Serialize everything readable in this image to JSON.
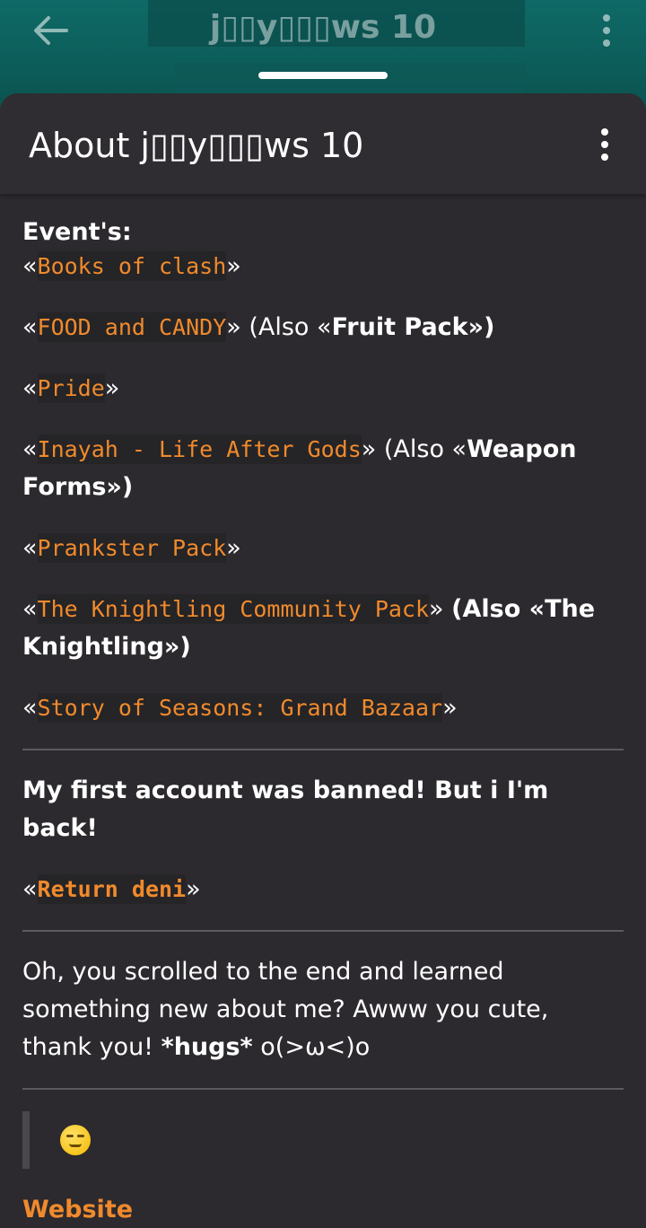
{
  "topbar": {
    "title": "j▯▯y▯▯▯ws 10"
  },
  "sheet": {
    "title": "About j▯▯y▯▯▯ws 10"
  },
  "content": {
    "events_heading": "Event's:",
    "lines": [
      {
        "code": "Books of clash",
        "suffix": "",
        "bold_tail": ""
      },
      {
        "code": "FOOD and CANDY",
        "suffix": " (Also «",
        "bold_tail": "Fruit Pack»)"
      },
      {
        "code": "Pride",
        "suffix": "",
        "bold_tail": ""
      },
      {
        "code": "Inayah - Life After Gods",
        "suffix": " (Also «",
        "bold_tail": "Weapon Forms»)"
      },
      {
        "code": "Prankster Pack",
        "suffix": "",
        "bold_tail": ""
      },
      {
        "code": "The Knightling Community Pack",
        "suffix": " ",
        "bold_tail": "(Also «The Knightling»)"
      },
      {
        "code": "Story of Seasons: Grand Bazaar",
        "suffix": "",
        "bold_tail": ""
      }
    ],
    "banned_text": "My first account was banned! But i I'm back!",
    "return_code": "Return deni",
    "closing_text_1": "Oh, you scrolled to the end and learned something new about me? Awww you cute, thank you! ",
    "closing_bold": "*hugs*",
    "closing_text_2": " o(>ω<)o",
    "website_label": "Website"
  },
  "icons": {
    "back": "arrow-left-icon",
    "more": "more-vertical-icon",
    "emoji": "smirking-face-emoji"
  },
  "colors": {
    "accent": "#f08a2c",
    "sheet_bg": "#2c2a2e",
    "header_bg": "#0f5c5a"
  }
}
